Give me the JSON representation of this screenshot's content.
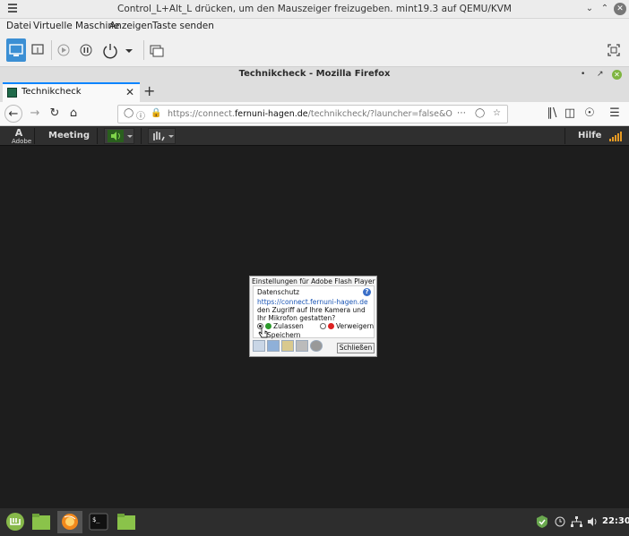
{
  "host": {
    "title": "Control_L+Alt_L drücken, um den Mauszeiger freizugeben. mint19.3 auf QEMU/KVM",
    "menu": [
      "Datei",
      "Virtuelle Maschine",
      "Anzeigen",
      "Taste senden"
    ]
  },
  "firefox": {
    "window_title": "Technikcheck - Mozilla Firefox",
    "tab_label": "Technikcheck",
    "url_prefix": "https://connect.",
    "url_domain": "fernuni-hagen.de",
    "url_rest": "/technikcheck/?launcher=false&OWASP_CSF"
  },
  "adobe": {
    "logo_text": "Adobe",
    "meeting_label": "Meeting",
    "help_label": "Hilfe"
  },
  "flash": {
    "title": "Einstellungen für Adobe Flash Player",
    "section": "Datenschutz",
    "link": "https://connect.fernuni-hagen.de",
    "message": " den Zugriff auf Ihre Kamera und Ihr Mikrofon gestatten?",
    "allow": "Zulassen",
    "deny": "Verweigern",
    "remember": "Speichern",
    "close": "Schließen",
    "help_glyph": "?"
  },
  "taskbar": {
    "clock": "22:30"
  },
  "colors": {
    "accent": "#3b8fd4",
    "adobe_bar": "#2f2f2f",
    "desktop": "#1d1d1d"
  }
}
